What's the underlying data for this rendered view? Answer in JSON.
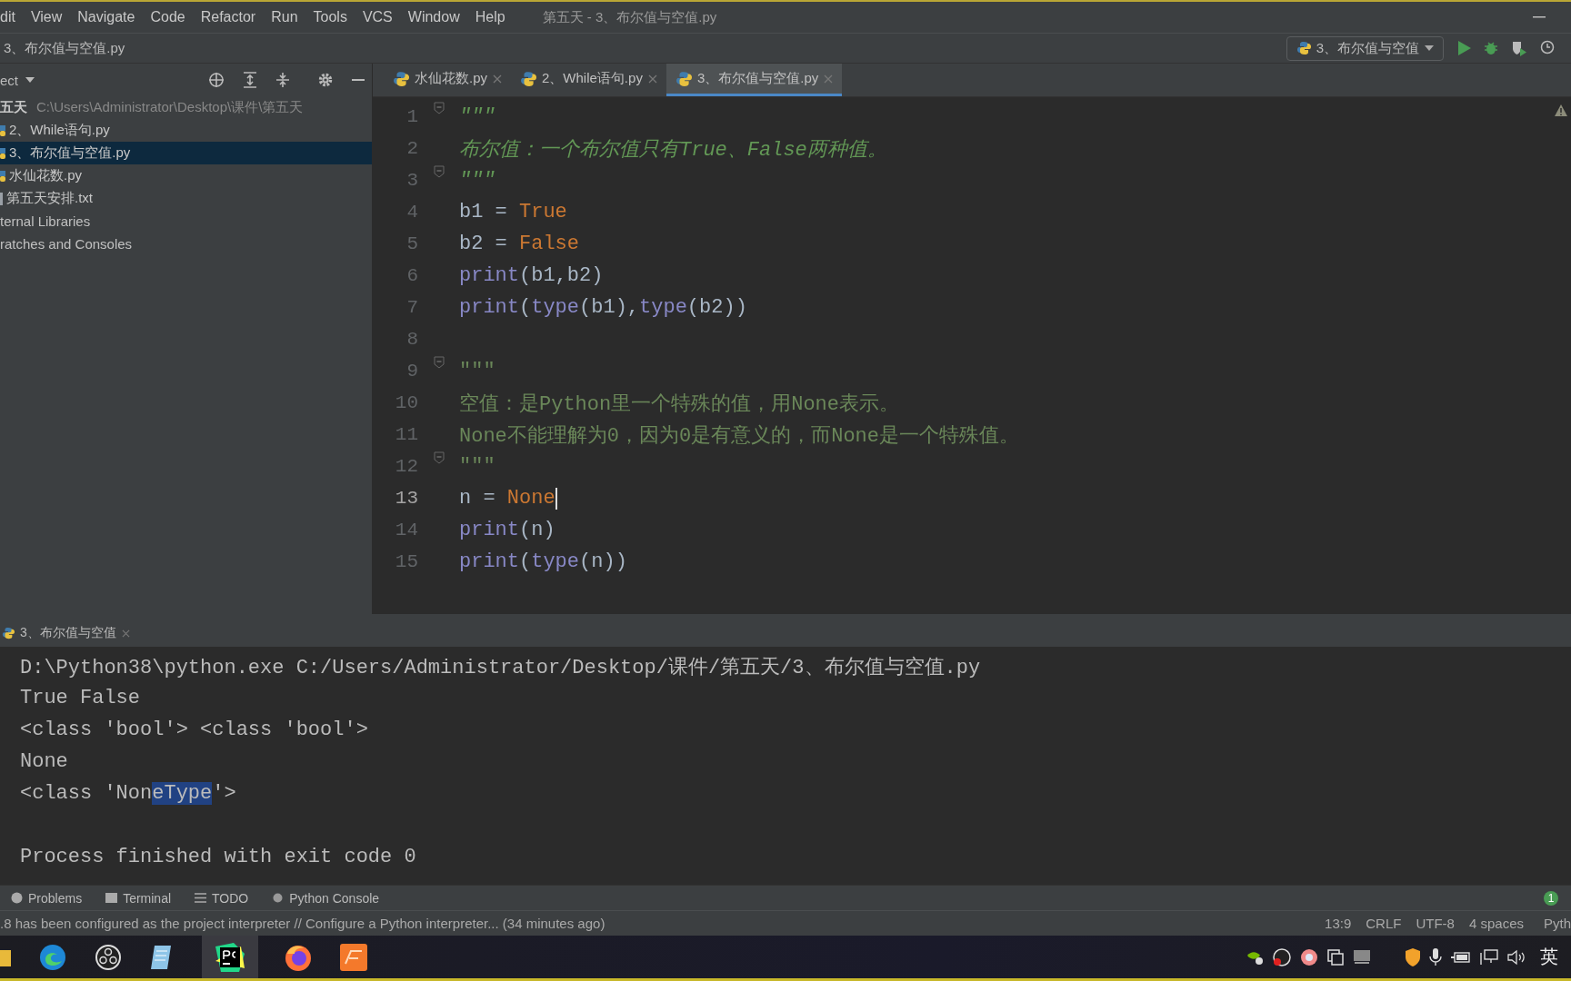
{
  "menu": [
    "dit",
    "View",
    "Navigate",
    "Code",
    "Refactor",
    "Run",
    "Tools",
    "VCS",
    "Window",
    "Help"
  ],
  "window": {
    "title": "第五天 - 3、布尔值与空值.py"
  },
  "breadcrumb": "3、布尔值与空值.py",
  "run_config": {
    "label": "3、布尔值与空值"
  },
  "project": {
    "header": "ect",
    "root": {
      "name": "五天",
      "path": "C:\\Users\\Administrator\\Desktop\\课件\\第五天"
    },
    "items": [
      {
        "name": "2、While语句.py",
        "kind": "python",
        "selected": false
      },
      {
        "name": "3、布尔值与空值.py",
        "kind": "python",
        "selected": true
      },
      {
        "name": "水仙花数.py",
        "kind": "python",
        "selected": false
      },
      {
        "name": "第五天安排.txt",
        "kind": "text",
        "selected": false
      }
    ],
    "extra": [
      "ternal Libraries",
      "ratches and Consoles"
    ]
  },
  "tabs": [
    {
      "label": "水仙花数.py",
      "selected": false
    },
    {
      "label": "2、While语句.py",
      "selected": false
    },
    {
      "label": "3、布尔值与空值.py",
      "selected": true
    }
  ],
  "code": [
    {
      "num": "1",
      "fold": true,
      "current": false,
      "tokens": [
        {
          "kind": "doc",
          "text": "\"\"\""
        }
      ]
    },
    {
      "num": "2",
      "fold": false,
      "current": false,
      "tokens": [
        {
          "kind": "doc",
          "text": "布尔值：一个布尔值只有True、False两种值。"
        }
      ]
    },
    {
      "num": "3",
      "fold": true,
      "current": false,
      "tokens": [
        {
          "kind": "doc",
          "text": "\"\"\""
        }
      ]
    },
    {
      "num": "4",
      "fold": false,
      "current": false,
      "tokens": [
        {
          "kind": "plain",
          "text": "b1 = "
        },
        {
          "kind": "keyword",
          "text": "True"
        }
      ]
    },
    {
      "num": "5",
      "fold": false,
      "current": false,
      "tokens": [
        {
          "kind": "plain",
          "text": "b2 = "
        },
        {
          "kind": "keyword",
          "text": "False"
        }
      ]
    },
    {
      "num": "6",
      "fold": false,
      "current": false,
      "tokens": [
        {
          "kind": "builtin",
          "text": "print"
        },
        {
          "kind": "plain",
          "text": "(b1,b2)"
        }
      ]
    },
    {
      "num": "7",
      "fold": false,
      "current": false,
      "tokens": [
        {
          "kind": "builtin",
          "text": "print"
        },
        {
          "kind": "plain",
          "text": "("
        },
        {
          "kind": "builtin",
          "text": "type"
        },
        {
          "kind": "plain",
          "text": "(b1),"
        },
        {
          "kind": "builtin",
          "text": "type"
        },
        {
          "kind": "plain",
          "text": "(b2))"
        }
      ]
    },
    {
      "num": "8",
      "fold": false,
      "current": false
    },
    {
      "num": "9",
      "fold": true,
      "current": false,
      "tokens": [
        {
          "kind": "string",
          "text": "\"\"\""
        }
      ]
    },
    {
      "num": "10",
      "fold": false,
      "current": false,
      "tokens": [
        {
          "kind": "string",
          "text": "空值：是Python里一个特殊的值，用None表示。"
        }
      ]
    },
    {
      "num": "11",
      "fold": false,
      "current": false,
      "tokens": [
        {
          "kind": "string",
          "text": "None不能理解为0，因为0是有意义的，而None是一个特殊值。"
        }
      ]
    },
    {
      "num": "12",
      "fold": true,
      "current": false,
      "tokens": [
        {
          "kind": "string",
          "text": "\"\"\""
        }
      ]
    },
    {
      "num": "13",
      "fold": false,
      "current": true,
      "tokens": [
        {
          "kind": "plain",
          "text": "n = "
        },
        {
          "kind": "keyword",
          "text": "None"
        }
      ]
    },
    {
      "num": "14",
      "fold": false,
      "current": false,
      "tokens": [
        {
          "kind": "builtin",
          "text": "print"
        },
        {
          "kind": "plain",
          "text": "(n)"
        }
      ]
    },
    {
      "num": "15",
      "fold": false,
      "current": false,
      "tokens": [
        {
          "kind": "builtin",
          "text": "print"
        },
        {
          "kind": "plain",
          "text": "("
        },
        {
          "kind": "builtin",
          "text": "type"
        },
        {
          "kind": "plain",
          "text": "(n))"
        }
      ]
    }
  ],
  "run_tab": {
    "label": "3、布尔值与空值"
  },
  "console": [
    {
      "kind": "output",
      "segments": [
        {
          "text": "D:\\Python38\\python.exe C:/Users/Administrator/Desktop/课件/第五天/3、布尔值与空值.py",
          "selected": false
        }
      ]
    },
    {
      "kind": "output",
      "segments": [
        {
          "text": "True False",
          "selected": false
        }
      ]
    },
    {
      "kind": "output",
      "segments": [
        {
          "text": "<class 'bool'> <class 'bool'>",
          "selected": false
        }
      ]
    },
    {
      "kind": "output",
      "segments": [
        {
          "text": "None",
          "selected": false
        }
      ]
    },
    {
      "kind": "output",
      "segments": [
        {
          "text": "<class 'Non",
          "selected": false
        },
        {
          "text": "eType",
          "selected": true
        },
        {
          "text": "'>",
          "selected": false
        }
      ]
    },
    {
      "kind": "exit",
      "segments": [
        {
          "text": "Process finished with exit code 0",
          "selected": false
        }
      ]
    }
  ],
  "tool_tabs": [
    "Problems",
    "Terminal",
    "TODO",
    "Python Console"
  ],
  "notification_count": "1",
  "status": {
    "message": ".8 has been configured as the project interpreter // Configure a Python interpreter... (34 minutes ago)",
    "position": "13:9",
    "line_ending": "CRLF",
    "encoding": "UTF-8",
    "indent": "4 spaces",
    "interpreter": "Pyth"
  },
  "tray": {
    "language": "英"
  }
}
